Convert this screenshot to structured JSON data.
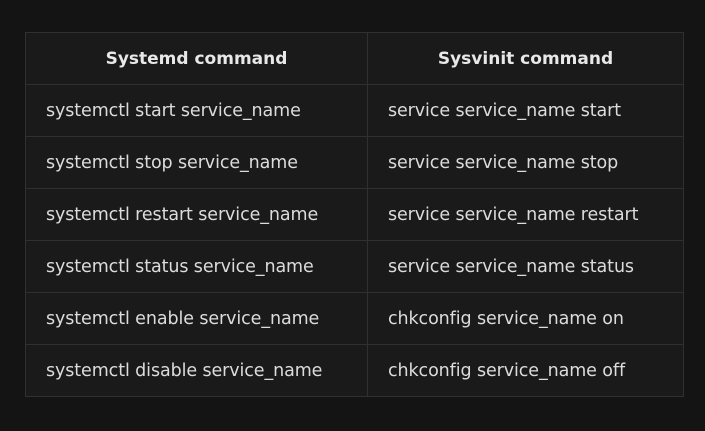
{
  "table": {
    "headers": [
      "Systemd command",
      "Sysvinit command"
    ],
    "rows": [
      [
        "systemctl start service_name",
        "service service_name start"
      ],
      [
        "systemctl stop service_name",
        "service service_name stop"
      ],
      [
        "systemctl restart service_name",
        "service service_name restart"
      ],
      [
        "systemctl status service_name",
        "service service_name status"
      ],
      [
        "systemctl enable service_name",
        "chkconfig service_name on"
      ],
      [
        "systemctl disable service_name",
        "chkconfig service_name off"
      ]
    ]
  },
  "colors": {
    "background": "#141414",
    "table_background": "#1a1a1a",
    "border": "#303030",
    "text": "#dcdcdc",
    "header_text": "#e8e8e8"
  }
}
